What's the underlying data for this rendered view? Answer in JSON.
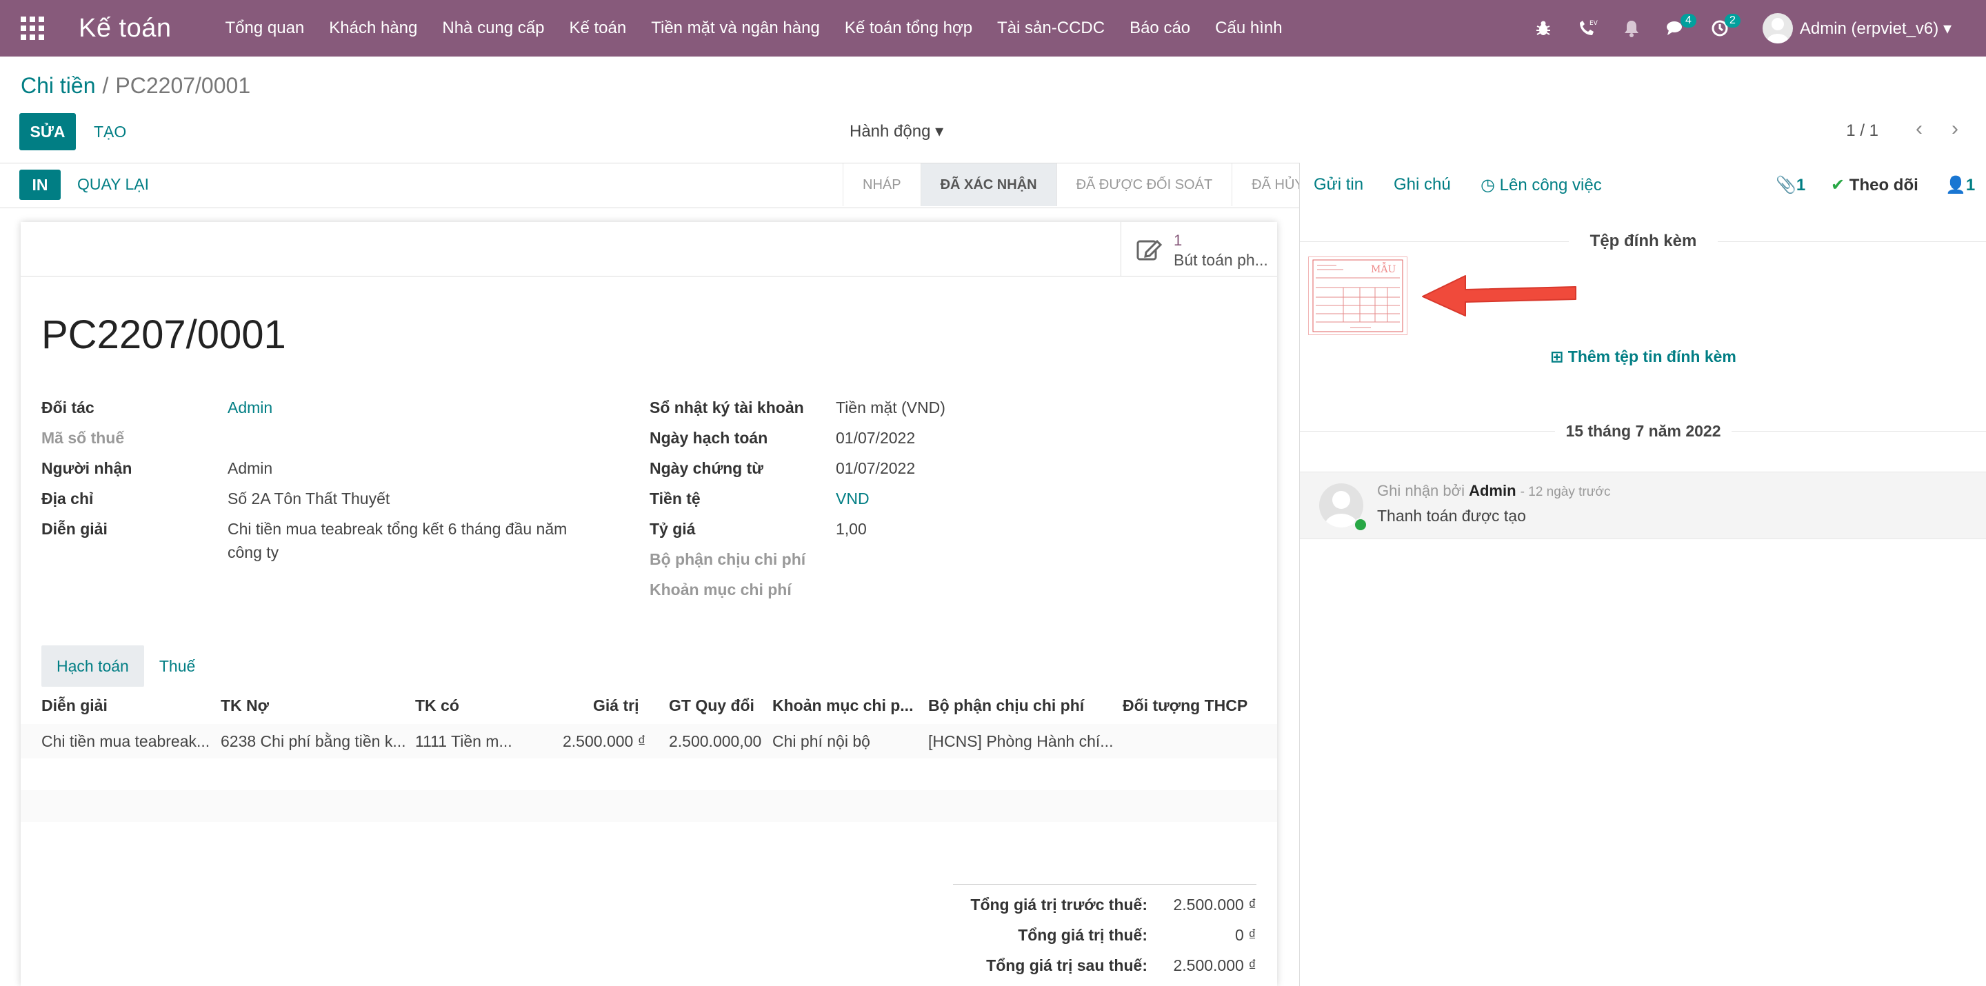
{
  "navbar": {
    "brand": "Kế toán",
    "menu": [
      "Tổng quan",
      "Khách hàng",
      "Nhà cung cấp",
      "Kế toán",
      "Tiền mặt và ngân hàng",
      "Kế toán tổng hợp",
      "Tài sản-CCDC",
      "Báo cáo",
      "Cấu hình"
    ],
    "badges": {
      "messages": "4",
      "activities": "2"
    },
    "voip_label": "EV",
    "user": "Admin (erpviet_v6)"
  },
  "breadcrumb": {
    "parent": "Chi tiền",
    "separator": "/",
    "current": "PC2207/0001"
  },
  "control": {
    "edit": "SỬA",
    "create": "TẠO",
    "action": "Hành động",
    "pager": "1 / 1"
  },
  "statusbar": {
    "print": "IN",
    "back": "QUAY LẠI",
    "stages": [
      {
        "label": "NHÁP",
        "active": false
      },
      {
        "label": "ĐÃ XÁC NHẬN",
        "active": true
      },
      {
        "label": "ĐÃ ĐƯỢC ĐỐI SOÁT",
        "active": false
      },
      {
        "label": "ĐÃ HỦY",
        "active": false
      }
    ]
  },
  "smart_button": {
    "count": "1",
    "label": "Bút toán ph..."
  },
  "form": {
    "title": "PC2207/0001",
    "left": [
      {
        "label": "Đối tác",
        "value": "Admin",
        "link": true,
        "muted": false
      },
      {
        "label": "Mã số thuế",
        "value": "",
        "link": false,
        "muted": true
      },
      {
        "label": "Người nhận",
        "value": "Admin",
        "link": false,
        "muted": false
      },
      {
        "label": "Địa chỉ",
        "value": "Số 2A Tôn Thất Thuyết",
        "link": false,
        "muted": false
      },
      {
        "label": "Diễn giải",
        "value": "Chi tiền mua teabreak tổng kết 6 tháng đầu năm",
        "value2": "công ty",
        "link": false,
        "muted": false
      }
    ],
    "right": [
      {
        "label": "Sổ nhật ký tài khoản",
        "value": "Tiền mặt (VND)",
        "link": false,
        "muted": false
      },
      {
        "label": "Ngày hạch toán",
        "value": "01/07/2022",
        "link": false,
        "muted": false
      },
      {
        "label": "Ngày chứng từ",
        "value": "01/07/2022",
        "link": false,
        "muted": false
      },
      {
        "label": "Tiền tệ",
        "value": "VND",
        "link": true,
        "muted": false
      },
      {
        "label": "Tỷ giá",
        "value": "1,00",
        "link": false,
        "muted": false
      },
      {
        "label": "Bộ phận chịu chi phí",
        "value": "",
        "link": false,
        "muted": true
      },
      {
        "label": "Khoản mục chi phí",
        "value": "",
        "link": false,
        "muted": true
      }
    ]
  },
  "tabs": [
    {
      "label": "Hạch toán",
      "active": true
    },
    {
      "label": "Thuế",
      "active": false
    }
  ],
  "table": {
    "headers": [
      "Diễn giải",
      "TK Nợ",
      "TK có",
      "Giá trị",
      "GT Quy đổi",
      "Khoản mục chi p...",
      "Bộ phận chịu chi phí",
      "Đối tượng THCP"
    ],
    "rows": [
      [
        "Chi tiền mua teabreak...",
        "6238 Chi phí bằng tiền k...",
        "1111 Tiền m...",
        "2.500.000 ₫",
        "2.500.000,00",
        "Chi phí nội bộ",
        "[HCNS] Phòng Hành chí...",
        ""
      ]
    ]
  },
  "totals": [
    {
      "label": "Tổng giá trị trước thuế:",
      "value": "2.500.000 ₫"
    },
    {
      "label": "Tổng giá trị thuế:",
      "value": "0 ₫"
    },
    {
      "label": "Tổng giá trị sau thuế:",
      "value": "2.500.000 ₫"
    }
  ],
  "chatter": {
    "send": "Gửi tin",
    "note": "Ghi chú",
    "activity": "Lên công việc",
    "attachments_count": "1",
    "follow": "Theo dõi",
    "followers_count": "1",
    "attachments_title": "Tệp đính kèm",
    "attachment_stamp": "MẪU",
    "add_attachment": "Thêm tệp tin đính kèm",
    "date": "15 tháng 7 năm 2022",
    "message": {
      "prefix": "Ghi nhận bởi",
      "author": "Admin",
      "time": "- 12 ngày trước",
      "body": "Thanh toán được tạo"
    }
  },
  "colors": {
    "navbar": "#875a7b",
    "primary": "#017e84",
    "arrow": "#f04a3b"
  }
}
